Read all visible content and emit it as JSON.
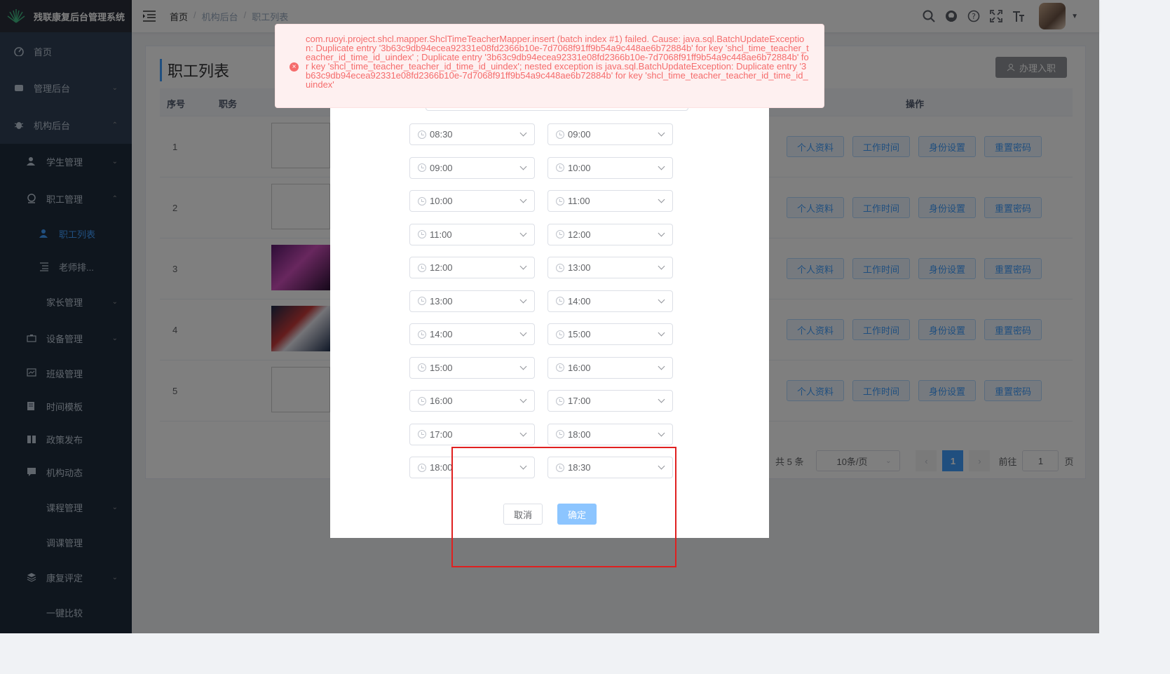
{
  "app": {
    "title": "残联康复后台管理系统"
  },
  "sidebar": {
    "items": [
      {
        "label": "首页",
        "icon": "dashboard-icon"
      },
      {
        "label": "管理后台",
        "icon": "system-icon"
      },
      {
        "label": "机构后台",
        "icon": "bug-icon"
      },
      {
        "label": "学生管理",
        "icon": "peoples-icon"
      },
      {
        "label": "职工管理",
        "icon": "staff-icon"
      },
      {
        "label": "职工列表",
        "icon": "user-icon"
      },
      {
        "label": "老师排...",
        "icon": "list-icon"
      },
      {
        "label": "家长管理"
      },
      {
        "label": "设备管理",
        "icon": "device-icon"
      },
      {
        "label": "班级管理",
        "icon": "class-icon"
      },
      {
        "label": "时间模板",
        "icon": "template-icon"
      },
      {
        "label": "政策发布",
        "icon": "policy-icon"
      },
      {
        "label": "机构动态",
        "icon": "message-icon"
      },
      {
        "label": "课程管理"
      },
      {
        "label": "调课管理"
      },
      {
        "label": "康复评定",
        "icon": "layers-icon"
      },
      {
        "label": "一键比较"
      }
    ]
  },
  "breadcrumb": [
    "首页",
    "机构后台",
    "职工列表"
  ],
  "page": {
    "title": "职工列表",
    "onboard_button": "办理入职",
    "columns": {
      "index": "序号",
      "position": "职务",
      "actions": "操作"
    },
    "rows": [
      {
        "index": "1"
      },
      {
        "index": "2"
      },
      {
        "index": "3"
      },
      {
        "index": "4"
      },
      {
        "index": "5"
      }
    ],
    "row_actions": [
      "个人资料",
      "工作时间",
      "身份设置",
      "重置密码"
    ],
    "pagination": {
      "total": "共 5 条",
      "page_size": "10条/页",
      "current": "1",
      "goto_label": "前往",
      "goto_value": "1",
      "page_suffix": "页"
    }
  },
  "dialog": {
    "time_rows": [
      {
        "start": "08:30",
        "end": "09:00"
      },
      {
        "start": "09:00",
        "end": "10:00"
      },
      {
        "start": "10:00",
        "end": "11:00"
      },
      {
        "start": "11:00",
        "end": "12:00"
      },
      {
        "start": "12:00",
        "end": "13:00"
      },
      {
        "start": "13:00",
        "end": "14:00"
      },
      {
        "start": "14:00",
        "end": "15:00"
      },
      {
        "start": "15:00",
        "end": "16:00"
      },
      {
        "start": "16:00",
        "end": "17:00"
      },
      {
        "start": "17:00",
        "end": "18:00"
      },
      {
        "start": "18:00",
        "end": "18:30"
      }
    ],
    "cancel": "取消",
    "confirm": "确定"
  },
  "error": {
    "message": "com.ruoyi.project.shcl.mapper.ShclTimeTeacherMapper.insert (batch index #1) failed. Cause: java.sql.BatchUpdateException: Duplicate entry '3b63c9db94ecea92331e08fd2366b10e-7d7068f91ff9b54a9c448ae6b72884b' for key 'shcl_time_teacher_teacher_id_time_id_uindex' ; Duplicate entry '3b63c9db94ecea92331e08fd2366b10e-7d7068f91ff9b54a9c448ae6b72884b' for key 'shcl_time_teacher_teacher_id_time_id_uindex'; nested exception is java.sql.BatchUpdateException: Duplicate entry '3b63c9db94ecea92331e08fd2366b10e-7d7068f91ff9b54a9c448ae6b72884b' for key 'shcl_time_teacher_teacher_id_time_id_uindex'",
    "color": "#f56c6c"
  },
  "colors": {
    "primary": "#409eff",
    "sidebar": "#304156",
    "highlight": "#e02020"
  }
}
